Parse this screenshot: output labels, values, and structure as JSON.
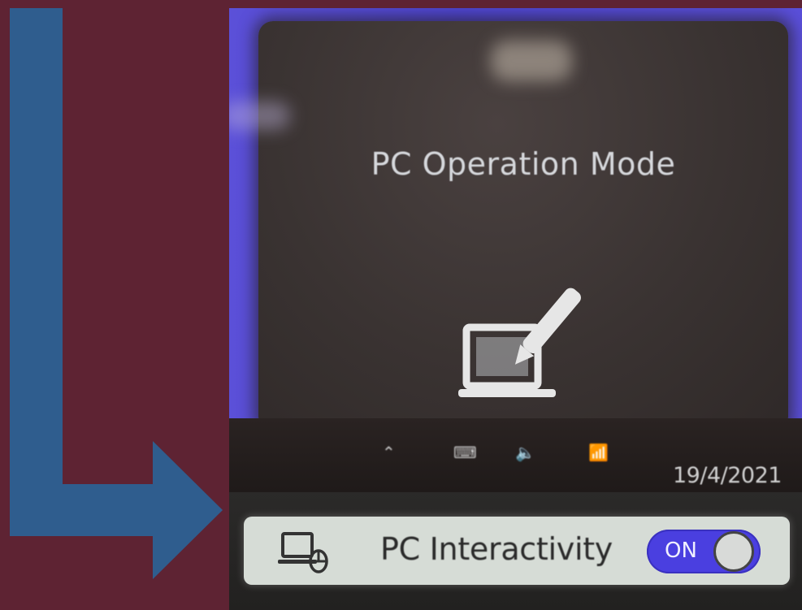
{
  "screen": {
    "title": "PC Operation Mode",
    "mode_icon": "laptop-pen-icon",
    "taskbar": {
      "tray_icons": [
        "chevron-up-icon",
        "keyboard-layout-icon",
        "volume-icon",
        "network-icon"
      ],
      "date": "19/4/2021"
    },
    "interactivity": {
      "icon": "laptop-mouse-icon",
      "label": "PC Interactivity",
      "toggle_label": "ON",
      "toggle_state": "on"
    }
  },
  "colors": {
    "arrow": "#2f5d8e",
    "background": "#5e2333",
    "toggle_on": "#4a3fe0"
  }
}
